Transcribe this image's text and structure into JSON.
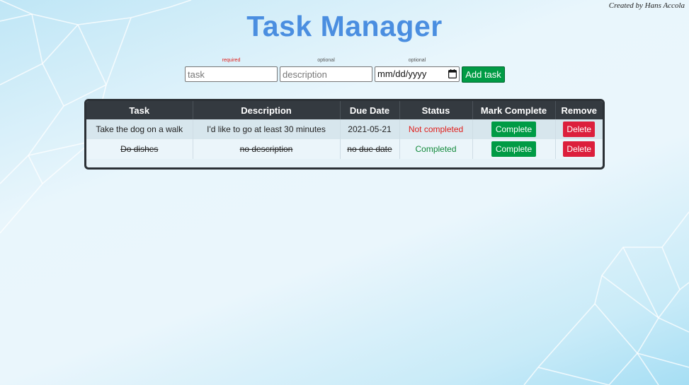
{
  "credit": "Created by Hans Accola",
  "title": "Task Manager",
  "form": {
    "task": {
      "hint": "required",
      "placeholder": "task",
      "value": ""
    },
    "description": {
      "hint": "optional",
      "placeholder": "description",
      "value": ""
    },
    "due_date": {
      "hint": "optional",
      "placeholder": "mm/dd/yyyy",
      "icon": "calendar-icon"
    },
    "add_label": "Add task"
  },
  "table": {
    "headers": [
      "Task",
      "Description",
      "Due Date",
      "Status",
      "Mark Complete",
      "Remove"
    ],
    "rows": [
      {
        "task": "Take the dog on a walk",
        "description": "I'd like to go at least 30 minutes",
        "due": "2021-05-21",
        "status": "Not completed",
        "complete_label": "Complete",
        "delete_label": "Delete"
      },
      {
        "task": "Do dishes",
        "description": "no description",
        "due": "no due date",
        "status": "Completed",
        "complete_label": "Complete",
        "delete_label": "Delete"
      }
    ]
  },
  "colors": {
    "title": "#4a8ee0",
    "primary_button": "#009b45",
    "danger_button": "#dc1f3c",
    "status_not_completed": "#e0201d",
    "status_completed": "#138a3b",
    "table_header": "#343a40"
  }
}
